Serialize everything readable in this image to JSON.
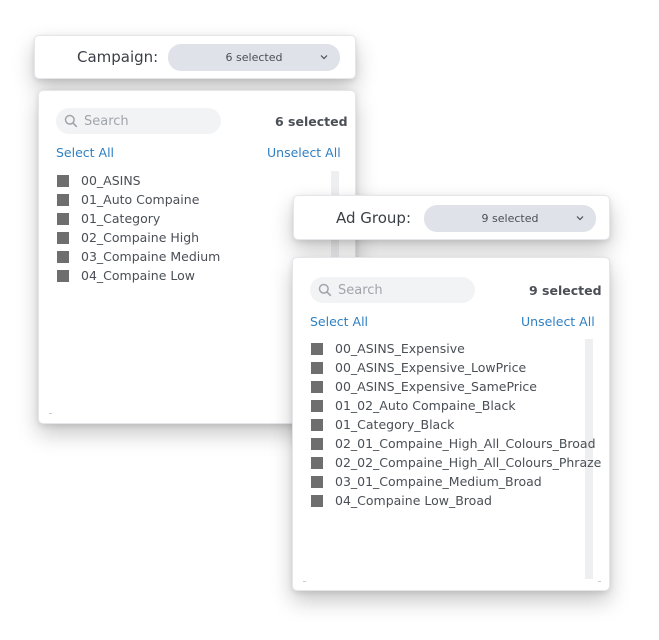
{
  "campaign": {
    "label": "Campaign:",
    "dropdown_value": "6 selected",
    "search_placeholder": "Search",
    "selected_count": "6 selected",
    "select_all": "Select All",
    "unselect_all": "Unselect All",
    "items": [
      "00_ASINS",
      "01_Auto Compaine",
      "01_Category",
      "02_Compaine High",
      "03_Compaine Medium",
      "04_Compaine Low"
    ]
  },
  "ad_group": {
    "label": "Ad Group:",
    "dropdown_value": "9 selected",
    "search_placeholder": "Search",
    "selected_count": "9 selected",
    "select_all": "Select All",
    "unselect_all": "Unselect All",
    "items": [
      "00_ASINS_Expensive",
      "00_ASINS_Expensive_LowPrice",
      "00_ASINS_Expensive_SamePrice",
      "01_02_Auto Compaine_Black",
      "01_Category_Black",
      "02_01_Compaine_High_All_Colours_Broad",
      "02_02_Compaine_High_All_Colours_Phraze",
      "03_01_Compaine_Medium_Broad",
      "04_Compaine Low_Broad"
    ]
  },
  "icons": {
    "search": "search-icon",
    "chevron": "chevron-down-icon",
    "checkbox": "checkbox-checked"
  },
  "colors": {
    "link": "#2f7fc1",
    "dropdown_bg": "#dfe2e9",
    "search_bg": "#f2f3f5",
    "checkbox": "#6e6e6e"
  }
}
